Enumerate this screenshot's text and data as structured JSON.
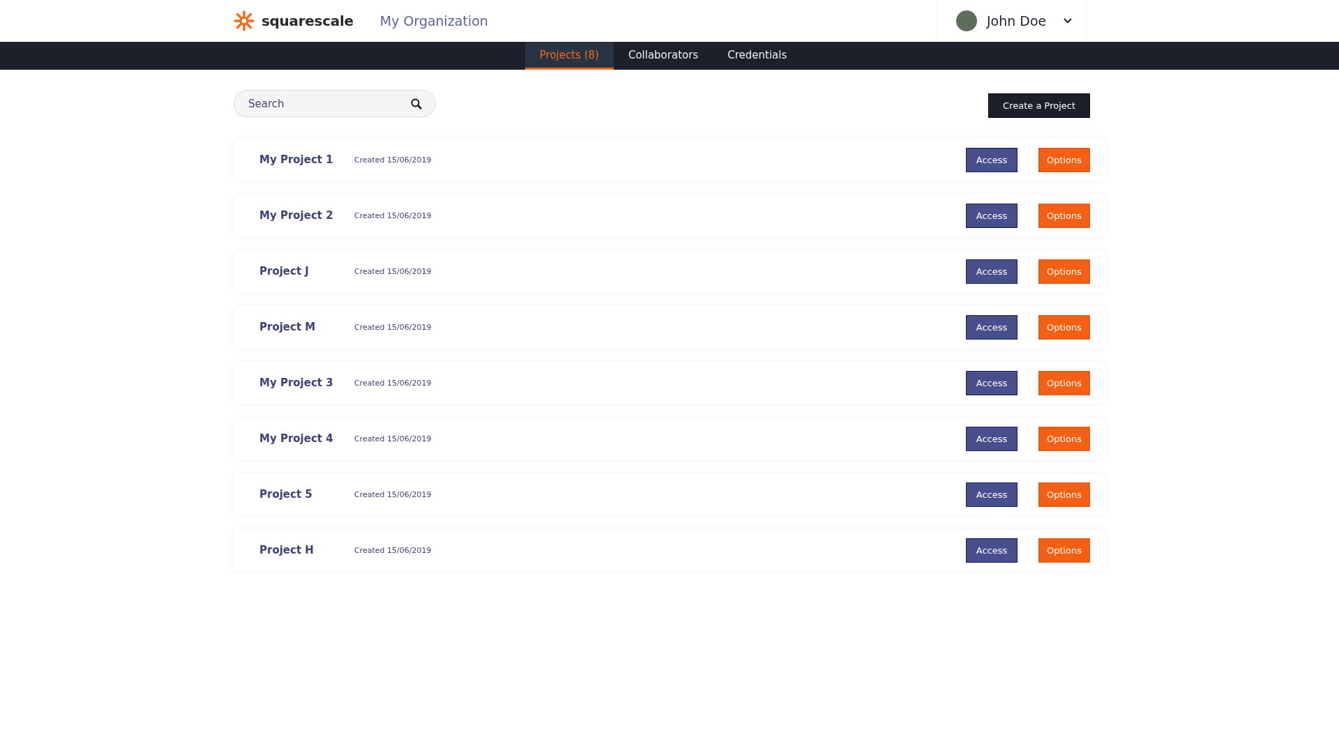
{
  "header": {
    "logo_text": "squarescale",
    "organization": "My Organization",
    "user": {
      "name": "John Doe"
    }
  },
  "tabs": [
    {
      "label": "Projects (8)",
      "selected": true
    },
    {
      "label": "Collaborators",
      "selected": false
    },
    {
      "label": "Credentials",
      "selected": false
    }
  ],
  "search": {
    "placeholder": "Search"
  },
  "create_button": "Create a Project",
  "projects": [
    {
      "name": "My Project 1",
      "created": "Created 15/06/2019",
      "access": "Access",
      "options": "Options"
    },
    {
      "name": "My Project 2",
      "created": "Created 15/06/2019",
      "access": "Access",
      "options": "Options"
    },
    {
      "name": "Project J",
      "created": "Created 15/06/2019",
      "access": "Access",
      "options": "Options"
    },
    {
      "name": "Project M",
      "created": "Created 15/06/2019",
      "access": "Access",
      "options": "Options"
    },
    {
      "name": "My Project 3",
      "created": "Created 15/06/2019",
      "access": "Access",
      "options": "Options"
    },
    {
      "name": "My Project 4",
      "created": "Created 15/06/2019",
      "access": "Access",
      "options": "Options"
    },
    {
      "name": "Project 5",
      "created": "Created 15/06/2019",
      "access": "Access",
      "options": "Options"
    },
    {
      "name": "Project H",
      "created": "Created 15/06/2019",
      "access": "Access",
      "options": "Options"
    }
  ]
}
